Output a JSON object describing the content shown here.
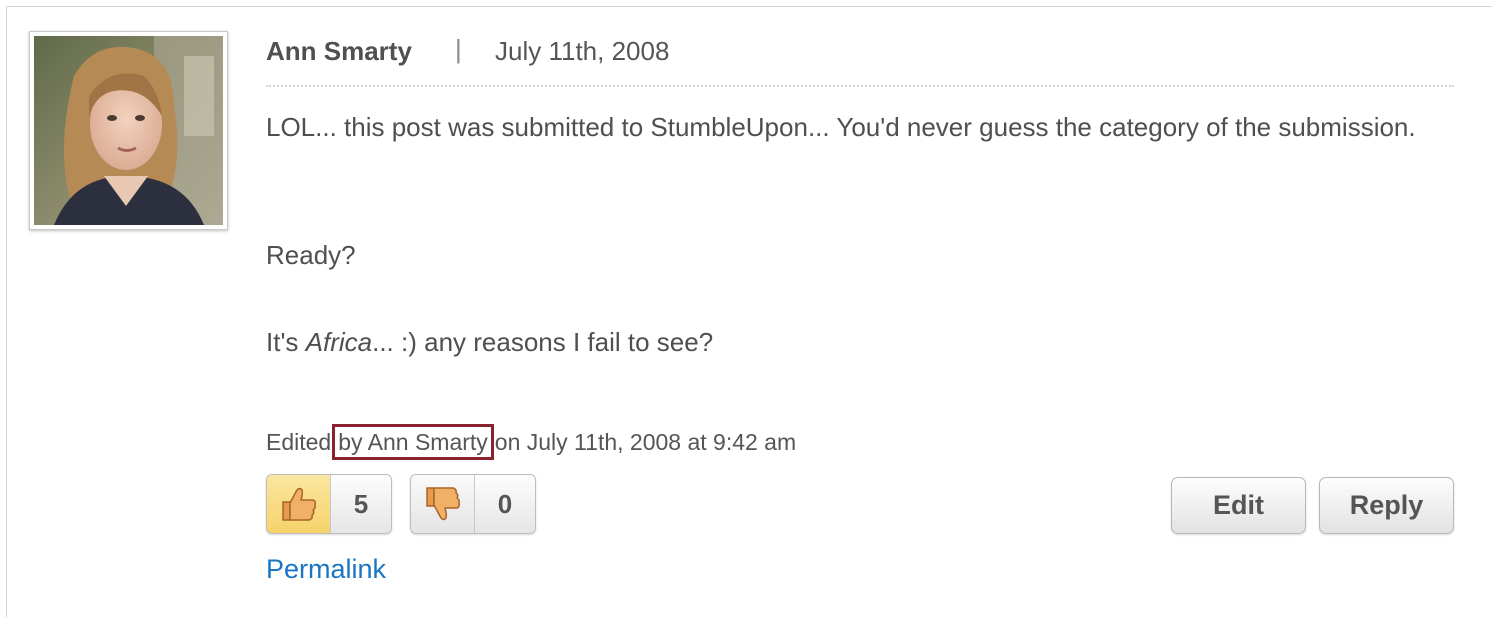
{
  "comment": {
    "author": "Ann Smarty",
    "separator": "|",
    "date": "July 11th, 2008",
    "paragraphs": {
      "p1": "LOL... this post was submitted to StumbleUpon... You'd never guess the category of the submission.",
      "p2": "Ready?",
      "p3_before": "It's ",
      "p3_italic": "Africa",
      "p3_after": "... :) any reasons I fail to see?"
    },
    "edited": {
      "prefix": "Edited",
      "by": "by Ann Smarty",
      "suffix": "on July 11th, 2008 at 9:42 am"
    }
  },
  "votes": {
    "up": {
      "count": "5",
      "icon": "thumbs-up-icon"
    },
    "down": {
      "count": "0",
      "icon": "thumbs-down-icon"
    }
  },
  "actions": {
    "edit_label": "Edit",
    "reply_label": "Reply",
    "permalink_label": "Permalink"
  },
  "colors": {
    "highlight_border": "#8b2230",
    "link": "#1a76c2",
    "upvote_bg": "#f6d26a"
  }
}
